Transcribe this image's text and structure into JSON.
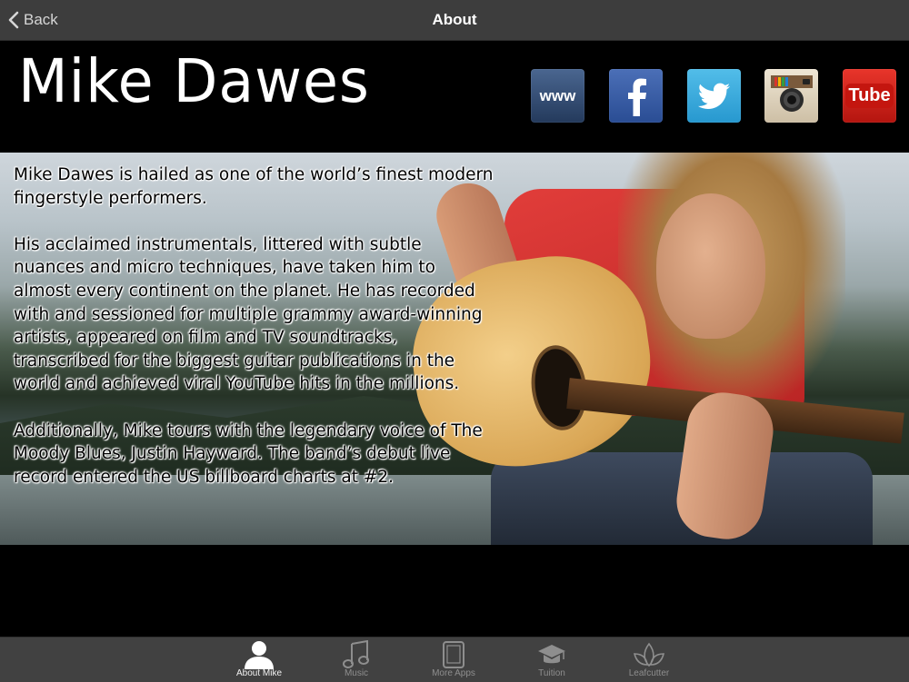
{
  "nav": {
    "back_label": "Back",
    "title": "About"
  },
  "header": {
    "logo_text": "Mike Dawes",
    "social": [
      {
        "icon": "www-icon",
        "label": "www"
      },
      {
        "icon": "facebook-icon",
        "label": "f"
      },
      {
        "icon": "twitter-icon",
        "label": ""
      },
      {
        "icon": "instagram-icon",
        "label": ""
      },
      {
        "icon": "youtube-icon",
        "label": "Tube"
      }
    ]
  },
  "bio": {
    "p1": "Mike Dawes is hailed as one of the world’s finest modern fingerstyle performers.",
    "p2": "His acclaimed instrumentals, littered with subtle nuances and micro techniques, have taken him to almost every continent on the planet. He has recorded with and sessioned for multiple grammy award-winning artists, appeared on film and TV soundtracks, transcribed for the biggest guitar publications in the world and achieved viral YouTube hits in the millions.",
    "p3": "Additionally, Mike tours with the legendary voice of The Moody Blues, Justin Hayward. The band’s debut live record entered the US billboard charts at #2."
  },
  "tabs": [
    {
      "label": "About Mike",
      "icon": "person-icon",
      "active": true
    },
    {
      "label": "Music",
      "icon": "music-note-icon",
      "active": false
    },
    {
      "label": "More Apps",
      "icon": "tablet-icon",
      "active": false
    },
    {
      "label": "Tuition",
      "icon": "graduation-cap-icon",
      "active": false
    },
    {
      "label": "Leafcutter",
      "icon": "leaf-icon",
      "active": false
    }
  ],
  "colors": {
    "navbar_bg": "#3d3d3d",
    "tabbar_bg": "#414141",
    "active_tab": "#f2f2f2",
    "inactive_tab": "#8e8e8e"
  }
}
